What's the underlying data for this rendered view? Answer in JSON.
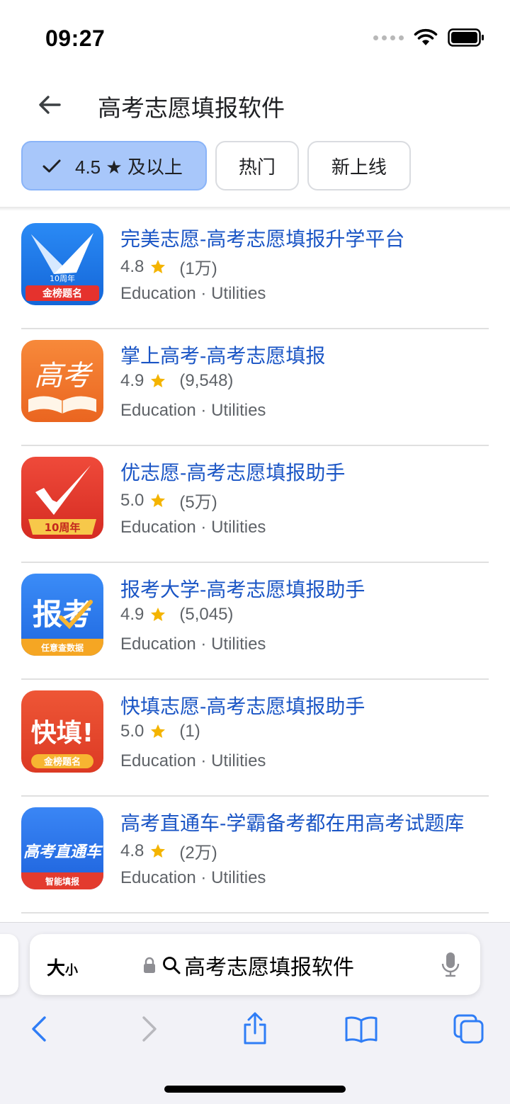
{
  "status_bar": {
    "time": "09:27"
  },
  "header": {
    "title": "高考志愿填报软件"
  },
  "filters": [
    {
      "label": "4.5 ★ 及以上",
      "active": true
    },
    {
      "label": "热门",
      "active": false
    },
    {
      "label": "新上线",
      "active": false
    }
  ],
  "apps": [
    {
      "name": "完美志愿-高考志愿填报升学平台",
      "rating": "4.8",
      "reviews": "(1万)",
      "category": "Education · Utilities",
      "icon_text": "10周年",
      "icon_badge": "金榜题名",
      "icon_color": "#1e7de8"
    },
    {
      "name": "掌上高考-高考志愿填报",
      "rating": "4.9",
      "reviews": "(9,548)",
      "category": "Education · Utilities",
      "icon_text": "高考",
      "icon_color": "#f0782a"
    },
    {
      "name": "优志愿-高考志愿填报助手",
      "rating": "5.0",
      "reviews": "(5万)",
      "category": "Education · Utilities",
      "icon_text": "10周年",
      "icon_color": "#e33b2e"
    },
    {
      "name": "报考大学-高考志愿填报助手",
      "rating": "4.9",
      "reviews": "(5,045)",
      "category": "Education · Utilities",
      "icon_text": "报考",
      "icon_badge": "任意查数据",
      "icon_color": "#2d7cf0"
    },
    {
      "name": "快填志愿-高考志愿填报助手",
      "rating": "5.0",
      "reviews": "(1)",
      "category": "Education · Utilities",
      "icon_text": "快填!",
      "icon_badge": "金榜题名",
      "icon_color": "#e8452f"
    },
    {
      "name": "高考直通车-学霸备考都在用高考试题库",
      "rating": "4.8",
      "reviews": "(2万)",
      "category": "Education · Utilities",
      "icon_text": "高考直通车",
      "icon_badge": "智能填报",
      "icon_color": "#2b73e6"
    }
  ],
  "browser": {
    "text_size_big": "大",
    "text_size_small": "小",
    "address": "高考志愿填报软件"
  },
  "colors": {
    "link": "#1a55c5",
    "chip_active": "#a8c7fa",
    "star": "#f4b400",
    "safari_blue": "#2f7df6"
  }
}
